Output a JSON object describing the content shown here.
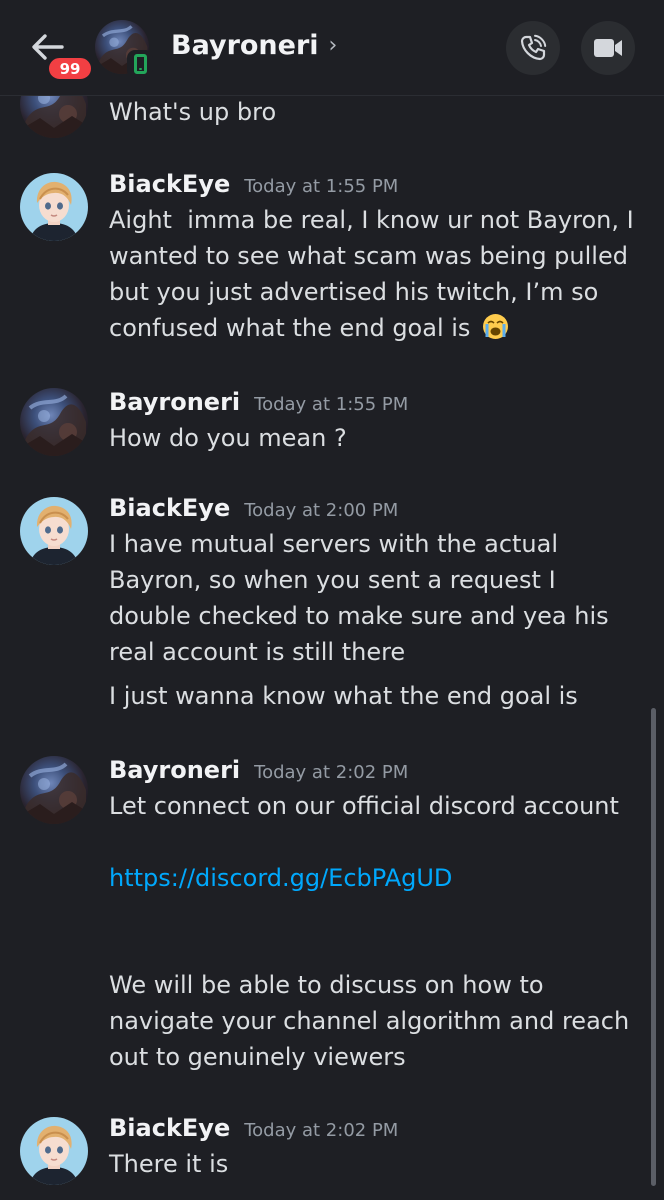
{
  "header": {
    "unread_count": "99",
    "title": "Bayroneri",
    "chevron": "›",
    "icons": {
      "back": "arrow-left-icon",
      "status": "mobile-online-icon",
      "call": "phone-call-icon",
      "video": "video-camera-icon"
    }
  },
  "colors": {
    "background": "#1e1f24",
    "badge": "#f23f43",
    "online": "#23a55a",
    "link": "#00a8fc",
    "timestamp": "#949ba4"
  },
  "messages": [
    {
      "author": "",
      "time": "",
      "lines": [
        "What's up bro"
      ]
    },
    {
      "author": "BiackEye",
      "time": "Today at 1:55 PM",
      "text": "Aight  imma be real, I know ur not Bayron, I wanted to see what scam was being pulled but you just advertised his twitch, I’m so confused what the end goal is",
      "emoji": "loudly-crying-face-emoji"
    },
    {
      "author": "Bayroneri",
      "time": "Today at 1:55 PM",
      "text": "How do you mean ?"
    },
    {
      "author": "BiackEye",
      "time": "Today at 2:00 PM",
      "text": "I have mutual servers with the actual Bayron, so when you sent a request I double checked to make sure and yea his real account is still there",
      "followup": "I just wanna know what the end goal is"
    },
    {
      "author": "Bayroneri",
      "time": "Today at 2:02 PM",
      "text": "Let connect on our official discord account",
      "link": "https://discord.gg/EcbPAgUD",
      "tail": "We will be able to discuss on how to navigate your channel algorithm and reach out to genuinely viewers"
    },
    {
      "author": "BiackEye",
      "time": "Today at 2:02 PM",
      "text": "There it is"
    }
  ]
}
